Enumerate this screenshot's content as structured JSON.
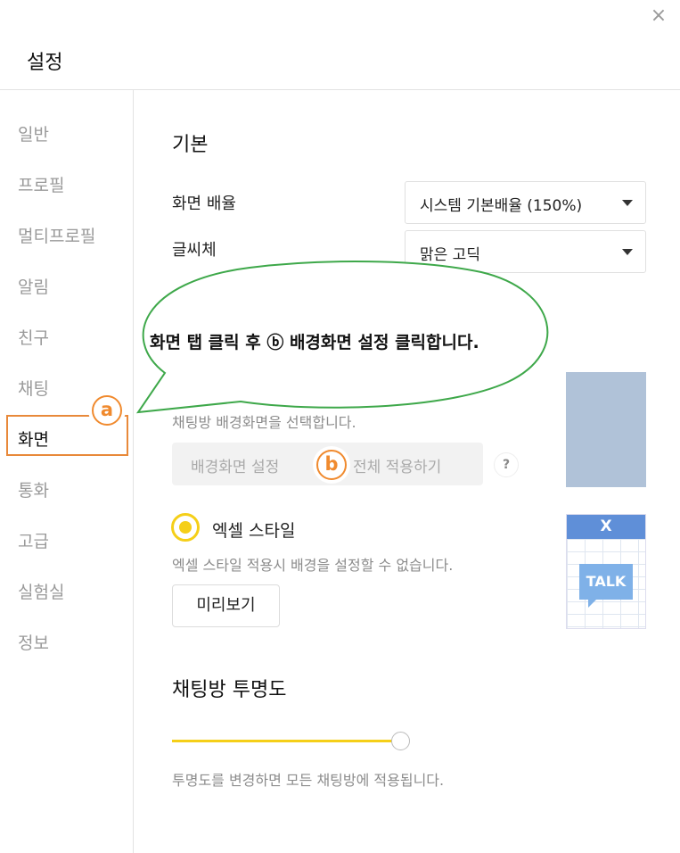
{
  "window": {
    "title": "설정",
    "close_icon": "×"
  },
  "sidebar": {
    "items": [
      {
        "label": "일반"
      },
      {
        "label": "프로필"
      },
      {
        "label": "멀티프로필"
      },
      {
        "label": "알림"
      },
      {
        "label": "친구"
      },
      {
        "label": "채팅"
      },
      {
        "label": "화면"
      },
      {
        "label": "통화"
      },
      {
        "label": "고급"
      },
      {
        "label": "실험실"
      },
      {
        "label": "정보"
      }
    ],
    "active": "화면"
  },
  "main": {
    "basic": {
      "title": "기본",
      "zoom_label": "화면 배율",
      "zoom_value": "시스템 기본배율 (150%)",
      "font_label": "글씨체",
      "font_value": "맑은 고딕"
    },
    "background": {
      "desc": "채팅방 배경화면을 선택합니다.",
      "set_button": "배경화면 설정",
      "apply_all": "전체 적용하기",
      "help": "?"
    },
    "excel": {
      "label": "엑셀 스타일",
      "desc": "엑셀 스타일 적용시 배경을 설정할 수 없습니다.",
      "preview_button": "미리보기",
      "logo": "X",
      "talk": "TALK"
    },
    "transparency": {
      "title": "채팅방 투명도",
      "desc": "투명도를 변경하면 모든 채팅방에 적용됩니다.",
      "level": 1.0
    }
  },
  "annotation": {
    "callout": "화면 탭 클릭 후 ⓑ 배경화면 설정 클릭합니다.",
    "badge_a": "a",
    "badge_b": "b"
  },
  "colors": {
    "accent": "#f5cf18",
    "highlight": "#e8893a",
    "callout_border": "#3ea84a"
  }
}
